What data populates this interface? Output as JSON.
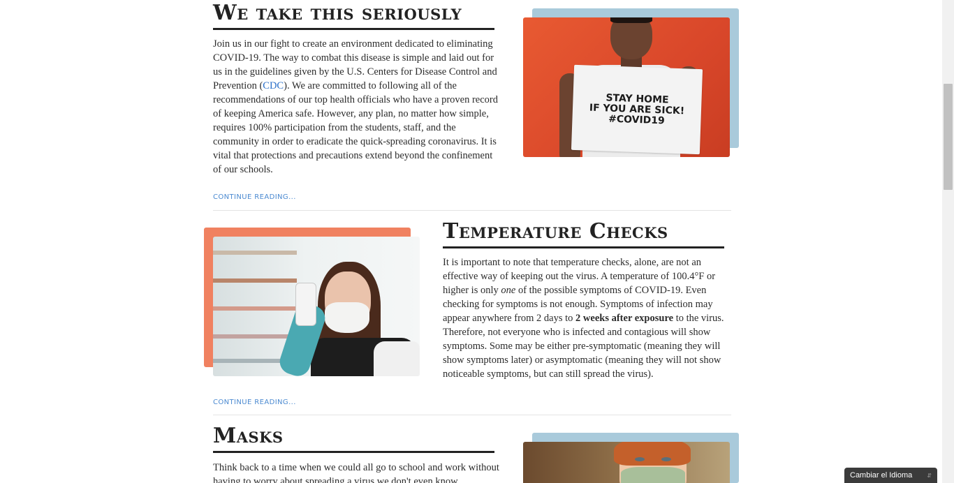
{
  "sections": [
    {
      "title": "We take this seriously",
      "body_parts": {
        "p1": "Join us in our fight to create an environment dedicated to eliminating COVID-19. The way to combat this disease is simple and laid out for us in the guidelines given by the U.S. Centers for Disease Control and Prevention (",
        "link": "CDC",
        "p2": "). We are committed to following all of the recommendations of our top health officials who have a proven record of keeping America safe. However, any plan, no matter how simple, requires 100% participation from the students, staff, and the community in order to eradicate the quick-spreading coronavirus. It is vital that protections and precautions extend beyond the confinement of our schools."
      },
      "continue": "CONTINUE READING...",
      "image": {
        "sign_lines": [
          "STAY HOME",
          "IF YOU ARE SICK!",
          "#COVID19"
        ],
        "accent_color": "#a9cadb"
      }
    },
    {
      "title": "Temperature Checks",
      "body_parts": {
        "p1": "It is important to note that temperature checks, alone, are not an effective way of keeping out the virus. A temperature of 100.4°F or higher is only ",
        "em": "one",
        "p2": " of the possible symptoms of COVID-19. Even checking for symptoms is not enough. Symptoms of infection may appear anywhere from 2 days to ",
        "strong": "2 weeks after exposure",
        "p3": " to the virus. Therefore, not everyone who is infected and contagious will show symptoms. Some may be either pre-symptomatic (meaning they will show symptoms later) or asymptomatic (meaning they will not show noticeable symptoms, but can still spread the virus)."
      },
      "continue": "CONTINUE READING...",
      "image": {
        "accent_color": "#f08160"
      }
    },
    {
      "title": "Masks",
      "body_parts": {
        "p1": "Think back to a time when we could all go to school and work without having to worry about spreading a virus we don't even know"
      },
      "image": {
        "accent_color": "#a9cadb"
      }
    }
  ],
  "language_widget": {
    "label": "Cambiar el Idioma",
    "icon": "updown-arrows-icon"
  },
  "colors": {
    "link": "#2a6fc9",
    "continue": "#4b8ad1",
    "title_rule": "#222222"
  }
}
